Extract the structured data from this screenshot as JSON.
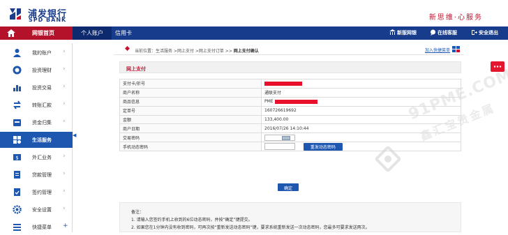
{
  "brand": {
    "name_cn": "浦发银行",
    "name_en": "SPD BANK",
    "slogan": "新思维·心服务"
  },
  "nav": {
    "home": "网银首页",
    "tabs": [
      "个人账户",
      "信用卡"
    ],
    "right": [
      "新版网银",
      "在线客服",
      "安全退出"
    ]
  },
  "sidebar": {
    "items": [
      {
        "label": "我的账户",
        "icon": "user-icon"
      },
      {
        "label": "投资理财",
        "icon": "coin-icon"
      },
      {
        "label": "投资交易",
        "icon": "trade-icon"
      },
      {
        "label": "转账汇款",
        "icon": "transfer-icon"
      },
      {
        "label": "资金归集",
        "icon": "collect-icon"
      },
      {
        "label": "生活服务",
        "icon": "life-service-icon",
        "active": true
      },
      {
        "label": "外汇业务",
        "icon": "forex-icon"
      },
      {
        "label": "贷款管理",
        "icon": "loan-icon"
      },
      {
        "label": "签约管理",
        "icon": "contract-icon"
      },
      {
        "label": "安全设置",
        "icon": "gear-icon"
      },
      {
        "label": "快捷菜单",
        "icon": "menu-icon"
      }
    ]
  },
  "breadcrumb": {
    "prefix": "当前位置：",
    "path": "生活服务 >网上支付 >网上支付订单 >> ",
    "current": "网上支付确认",
    "favorite": "加入快捷菜单"
  },
  "section_title": "网上支付",
  "form": {
    "rows": [
      {
        "label": "支付卡/折号",
        "value": ""
      },
      {
        "label": "商户名称",
        "value": "通联支付"
      },
      {
        "label": "商品信息",
        "value": "PME"
      },
      {
        "label": "定单号",
        "value": "160726619692"
      },
      {
        "label": "金额",
        "value": "133,400.00"
      },
      {
        "label": "商户日期",
        "value": "2016/07/26 14:10:44"
      },
      {
        "label": "交易密码",
        "value": ""
      },
      {
        "label": "手机动态密码",
        "value": ""
      }
    ],
    "send_code": "重发动态密码",
    "confirm": "确定"
  },
  "note": {
    "title": "备注：",
    "line1": "1. 请输入您签约手机上收到的6位动态密码，并按“确定”键提交。",
    "line2": "2. 如果您在1分钟内没有收到密码，可再次按“重新发送动态密码”键，要求系统重新发送一次动态密码，您最多可要求发送两次。"
  },
  "watermark": {
    "en": "91PME.COM",
    "cn": "鑫汇宝贵金属"
  },
  "colors": {
    "nav_blue": "#173c8c",
    "brand_red": "#c8102e",
    "active_blue": "#1e57b0"
  }
}
